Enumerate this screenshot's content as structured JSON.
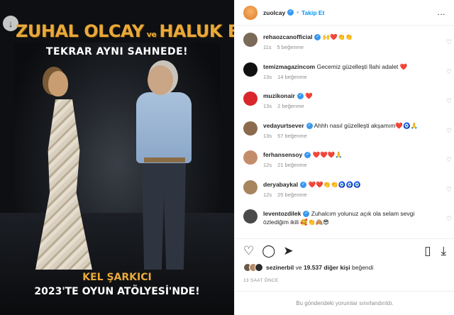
{
  "media": {
    "title_left": "ZUHAL OLCAY",
    "title_conj": "ve",
    "title_right": "HALUK BİLGİNER",
    "subtitle": "TEKRAR AYNI SAHNEDE!",
    "bottom_line1": "KEL ŞARKICI",
    "bottom_line2": "2023'TE OYUN ATÖLYESİ'NDE!",
    "download_icon": "download-icon",
    "title_color": "#e9a93a"
  },
  "header": {
    "username": "zuolcay",
    "separator": "•",
    "follow_label": "Takip Et",
    "more_icon": "…",
    "verified_color": "#3897f0",
    "follow_color": "#0095f6"
  },
  "comments": [
    {
      "user": "rehaozcanofficial",
      "text": "🙌❤️👏👏",
      "time": "11s",
      "likes": "5 beğenme",
      "avatar_color": "#7a6a58",
      "verified": true
    },
    {
      "user": "temizmagazincom",
      "text": "Gecemiz güzelleşti İlahi adalet ❤️",
      "time": "13s",
      "likes": "14 beğenme",
      "avatar_color": "#111111",
      "verified": false
    },
    {
      "user": "muzikonair",
      "text": "❤️",
      "time": "13s",
      "likes": "2 beğenme",
      "avatar_color": "#d8262b",
      "verified": true
    },
    {
      "user": "vedayurtsever",
      "text": "Ahhh nasıl güzelleşti akşamım❤️🧿🙏",
      "time": "13s",
      "likes": "57 beğenme",
      "avatar_color": "#8b6a4d",
      "verified": true
    },
    {
      "user": "ferhansensoy",
      "text": "❤️❤️❤️🙏",
      "time": "12s",
      "likes": "21 beğenme",
      "avatar_color": "#c48d6a",
      "verified": true
    },
    {
      "user": "deryabaykal",
      "text": "❤️❤️👏👏🧿🧿🧿",
      "time": "12s",
      "likes": "25 beğenme",
      "avatar_color": "#a7855e",
      "verified": true
    },
    {
      "user": "leventozdilek",
      "text": "Zuhalcım yolunuz açık ola selam sevgi özlediğim ikili 🥰👏🙈😎",
      "time": "",
      "likes": "",
      "avatar_color": "#4a4a4a",
      "verified": true
    }
  ],
  "comment_like_icon": "♡",
  "actions": {
    "like_icon": "♡",
    "comment_icon": "◯",
    "share_icon": "➤",
    "save_icon": "▯",
    "download_icon": "⤓"
  },
  "likes": {
    "user": "sezinerbil",
    "middle": "ve",
    "count_text": "19.537 diğer kişi",
    "suffix": "beğendi"
  },
  "timestamp": "13 SAAT ÖNCE",
  "limited_notice": "Bu gönderideki yorumlar sınırlandırıldı."
}
